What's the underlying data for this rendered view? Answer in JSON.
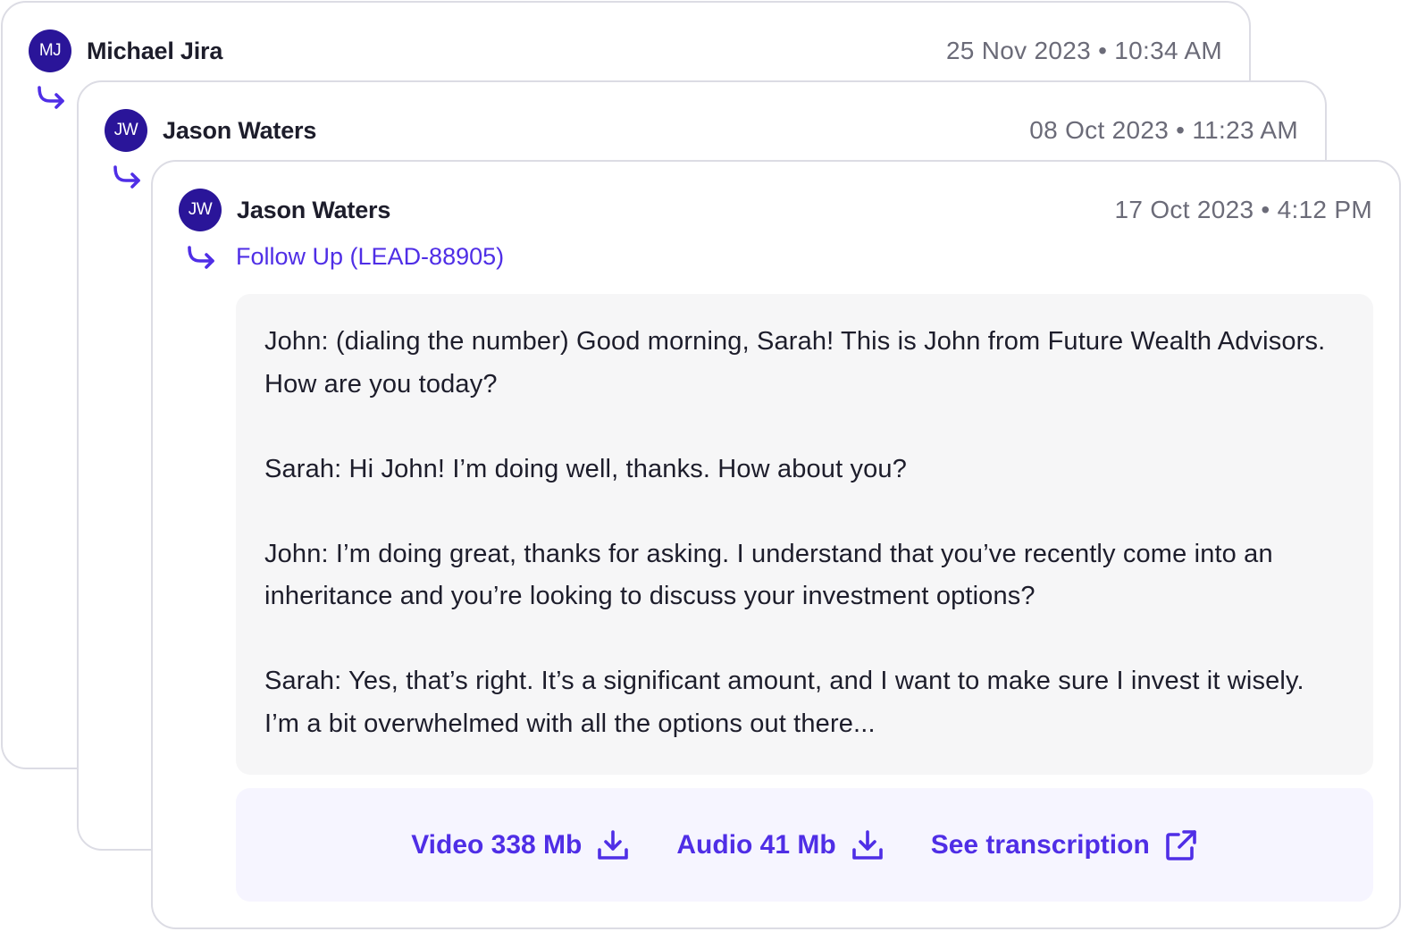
{
  "colors": {
    "accent": "#4f2ee6",
    "avatar_bg": "#2a1599",
    "attachments_bg": "#f6f5ff"
  },
  "messages": [
    {
      "avatar_initials": "MJ",
      "author": "Michael Jira",
      "date": "25 Nov 2023 • 10:34 AM"
    },
    {
      "avatar_initials": "JW",
      "author": "Jason Waters",
      "date": "08 Oct 2023 • 11:23 AM"
    },
    {
      "avatar_initials": "JW",
      "author": "Jason Waters",
      "date": "17 Oct 2023 • 4:12 PM",
      "reply_link": "Follow Up (LEAD-88905)",
      "body": [
        "John: (dialing the number) Good morning, Sarah! This is John from Future Wealth Advisors. How are you today?",
        "Sarah: Hi John! I’m doing well, thanks. How about you?",
        "John: I’m doing great, thanks for asking. I understand that you’ve recently come into an inheritance and you’re looking to discuss your investment options?",
        "Sarah: Yes, that’s right. It’s a significant amount, and I want to make sure I invest it wisely. I’m a bit overwhelmed with all the options out there..."
      ],
      "attachments": [
        {
          "label": "Video 338 Mb",
          "icon": "download-icon"
        },
        {
          "label": "Audio 41 Mb",
          "icon": "download-icon"
        },
        {
          "label": "See transcription",
          "icon": "external-link-icon"
        }
      ]
    }
  ]
}
